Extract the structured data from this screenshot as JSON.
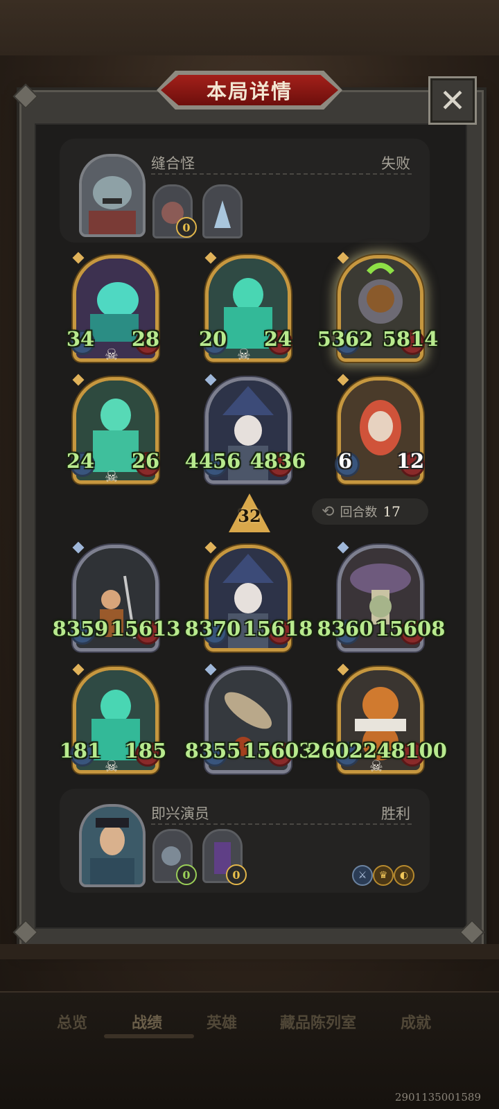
{
  "title": "本局详情",
  "close_label": "✕",
  "opponent": {
    "name": "缝合怪",
    "result": "失败",
    "badges": [
      "0"
    ]
  },
  "player": {
    "name": "即兴演员",
    "result": "胜利",
    "badges": [
      "0",
      "0"
    ]
  },
  "opponent_board": [
    {
      "atk": "34",
      "hp": "28",
      "frame": "gold",
      "deathrattle": true
    },
    {
      "atk": "20",
      "hp": "24",
      "frame": "gold",
      "deathrattle": true
    },
    {
      "atk": "5362",
      "hp": "5814",
      "frame": "gold",
      "highlighted": true
    },
    {
      "atk": "24",
      "hp": "26",
      "frame": "gold",
      "deathrattle": true
    },
    {
      "atk": "4456",
      "hp": "4836",
      "frame": "silver"
    },
    {
      "atk": "6",
      "hp": "12",
      "frame": "gold",
      "white_stats": true
    }
  ],
  "player_board": [
    {
      "atk": "8359",
      "hp": "15613",
      "frame": "silver"
    },
    {
      "atk": "8370",
      "hp": "15618",
      "frame": "gold"
    },
    {
      "atk": "8360",
      "hp": "15608",
      "frame": "silver"
    },
    {
      "atk": "181",
      "hp": "185",
      "frame": "gold",
      "deathrattle": true
    },
    {
      "atk": "8355",
      "hp": "15603",
      "frame": "silver"
    },
    {
      "atk": "26022",
      "hp": "48100",
      "frame": "gold",
      "deathrattle": true
    }
  ],
  "tavern_tier": "32",
  "rounds": {
    "label": "回合数",
    "value": "17"
  },
  "nav_tabs": [
    "总览",
    "战绩",
    "英雄",
    "藏品陈列室",
    "成就"
  ],
  "active_tab": "战绩",
  "user_id": "2901135001589",
  "colors": {
    "stat_green": "#b8ea8e",
    "gold_frame": "#c6973f",
    "title_red": "#a3201a"
  },
  "icons": [
    "close-icon",
    "skull-icon",
    "refresh-icon",
    "sword-icon",
    "crown-icon",
    "coin-icon"
  ]
}
